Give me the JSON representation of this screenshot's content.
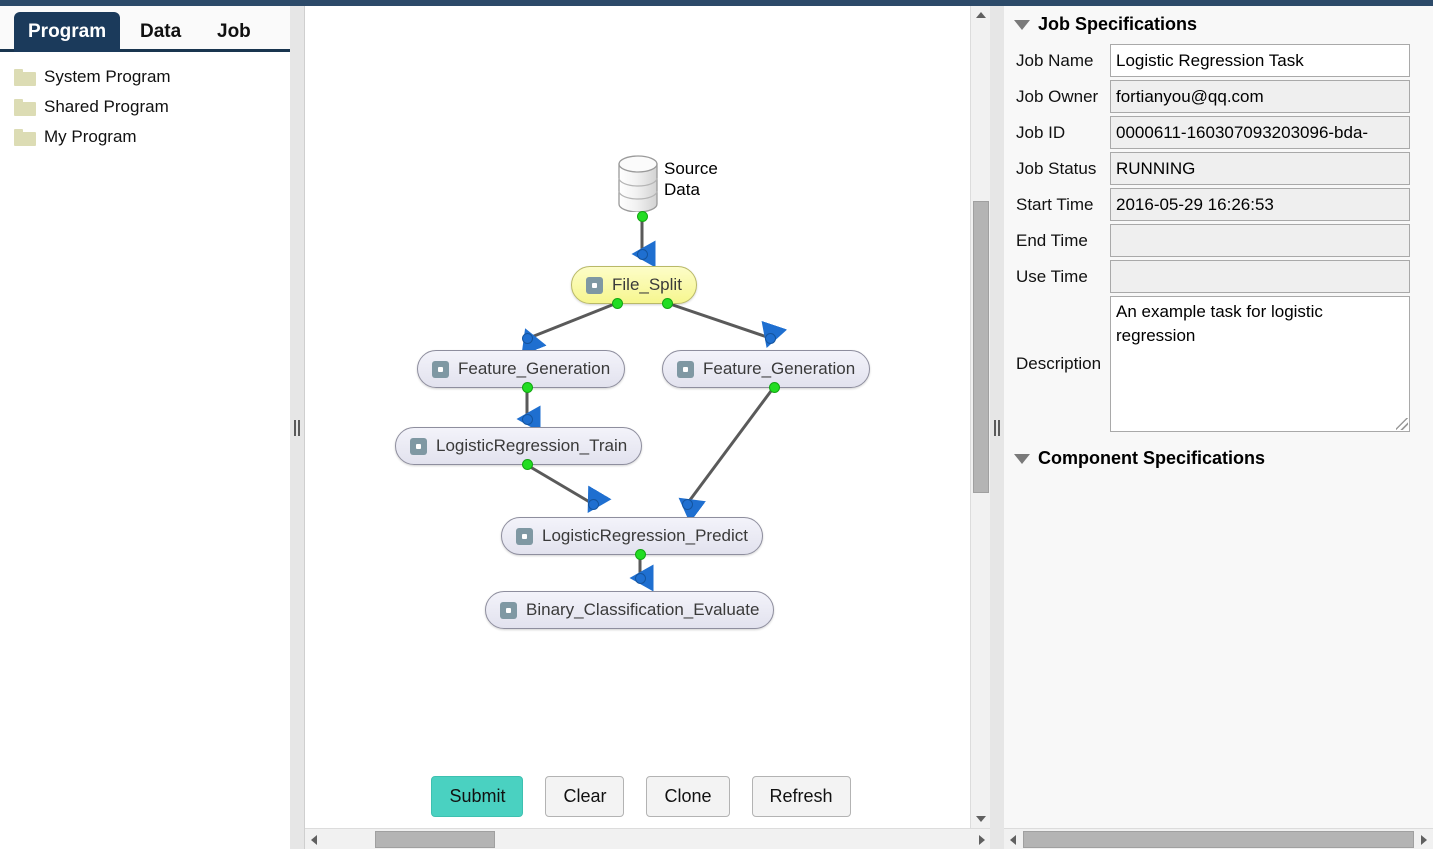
{
  "app": {
    "left_tabs": [
      {
        "label": "Program",
        "active": true
      },
      {
        "label": "Data",
        "active": false
      },
      {
        "label": "Job",
        "active": false
      }
    ],
    "program_tree": [
      {
        "label": "System Program",
        "icon": "folder-icon"
      },
      {
        "label": "Shared Program",
        "icon": "folder-icon"
      },
      {
        "label": "My Program",
        "icon": "folder-icon"
      }
    ]
  },
  "canvas": {
    "source_node": {
      "label_line1": "Source",
      "label_line2": "Data",
      "icon": "database-cylinder-icon"
    },
    "nodes": [
      {
        "id": "file_split",
        "label": "File_Split",
        "selected": true
      },
      {
        "id": "feature_generation_left",
        "label": "Feature_Generation",
        "selected": false
      },
      {
        "id": "feature_generation_right",
        "label": "Feature_Generation",
        "selected": false
      },
      {
        "id": "logisticregression_train",
        "label": "LogisticRegression_Train",
        "selected": false
      },
      {
        "id": "logisticregression_predict",
        "label": "LogisticRegression_Predict",
        "selected": false
      },
      {
        "id": "binary_classification_evaluate",
        "label": "Binary_Classification_Evaluate",
        "selected": false
      }
    ],
    "buttons": [
      {
        "id": "submit",
        "label": "Submit",
        "primary": true
      },
      {
        "id": "clear",
        "label": "Clear",
        "primary": false
      },
      {
        "id": "clone",
        "label": "Clone",
        "primary": false
      },
      {
        "id": "refresh",
        "label": "Refresh",
        "primary": false
      }
    ],
    "colors": {
      "selected_node": "#f6f68f",
      "node": "#e8e8f2",
      "primary_button": "#4ad1c1",
      "output_port": "#22dd22",
      "input_port": "#1f6fd0",
      "edge": "#5a5a5a"
    }
  },
  "right_panel": {
    "job_section_title": "Job Specifications",
    "component_section_title": "Component Specifications",
    "fields": [
      {
        "label": "Job Name",
        "value": "Logistic Regression Task",
        "editable": true
      },
      {
        "label": "Job Owner",
        "value": "fortianyou@qq.com",
        "editable": false
      },
      {
        "label": "Job ID",
        "value": "0000611-160307093203096-bda-",
        "editable": false
      },
      {
        "label": "Job Status",
        "value": "RUNNING",
        "editable": false
      },
      {
        "label": "Start Time",
        "value": "2016-05-29 16:26:53",
        "editable": false
      },
      {
        "label": "End Time",
        "value": "",
        "editable": false
      },
      {
        "label": "Use Time",
        "value": "",
        "editable": false
      }
    ],
    "description": {
      "label": "Description",
      "value": "An example task for logistic regression"
    }
  }
}
